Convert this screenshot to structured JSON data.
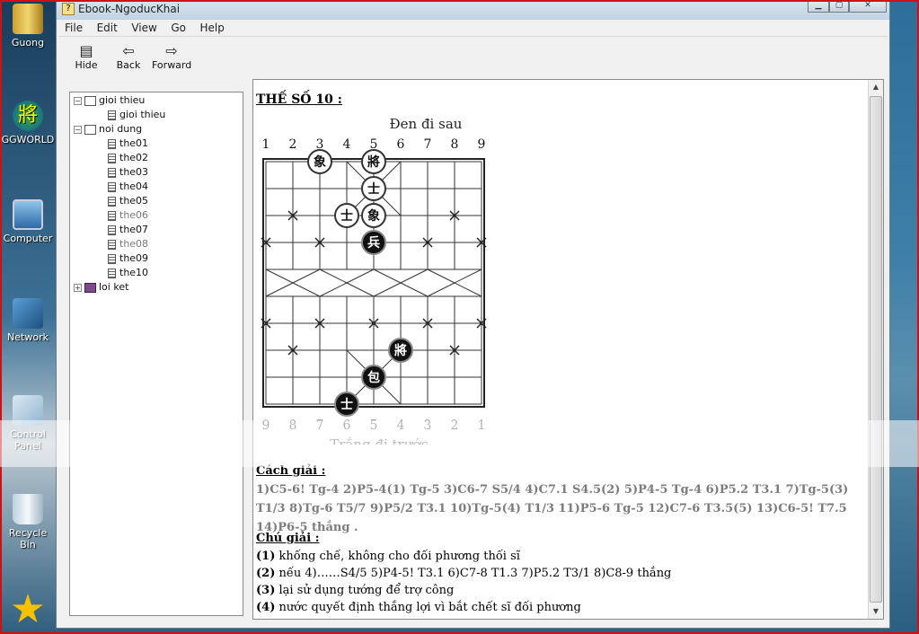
{
  "desktop": {
    "icons": [
      {
        "label": "Guong",
        "icon": "folder-icon"
      },
      {
        "label": "GGWORLD",
        "icon": "globe-app-icon"
      },
      {
        "label": "Computer",
        "icon": "computer-icon"
      },
      {
        "label": "Network",
        "icon": "network-icon"
      },
      {
        "label": "Control Panel",
        "icon": "control-panel-icon"
      },
      {
        "label": "Recycle Bin",
        "icon": "recycle-bin-icon"
      }
    ]
  },
  "window": {
    "title": "Ebook-NgoducKhai",
    "menu": [
      "File",
      "Edit",
      "View",
      "Go",
      "Help"
    ],
    "toolbar": {
      "hide": "Hide",
      "back": "Back",
      "forward": "Forward"
    }
  },
  "tree": {
    "nodes": [
      {
        "label": "gioi thieu",
        "type": "book-open",
        "expander": "-"
      },
      {
        "label": "gioi thieu",
        "type": "page"
      },
      {
        "label": "noi dung",
        "type": "book-open",
        "expander": "-"
      },
      {
        "label": "the01",
        "type": "page"
      },
      {
        "label": "the02",
        "type": "page"
      },
      {
        "label": "the03",
        "type": "page"
      },
      {
        "label": "the04",
        "type": "page"
      },
      {
        "label": "the05",
        "type": "page"
      },
      {
        "label": "the06",
        "type": "page"
      },
      {
        "label": "the07",
        "type": "page"
      },
      {
        "label": "the08",
        "type": "page"
      },
      {
        "label": "the09",
        "type": "page"
      },
      {
        "label": "the10",
        "type": "page"
      },
      {
        "label": "loi ket",
        "type": "book-closed",
        "expander": "+"
      }
    ]
  },
  "content": {
    "heading": "THẾ SỐ 10 :",
    "board": {
      "top_label": "Đen đi sau",
      "bottom_label": "Trắng đi trước",
      "top_files": [
        "1",
        "2",
        "3",
        "4",
        "5",
        "6",
        "7",
        "8",
        "9"
      ],
      "bottom_files": [
        "9",
        "8",
        "7",
        "6",
        "5",
        "4",
        "3",
        "2",
        "1"
      ],
      "pieces": [
        {
          "glyph": "象",
          "color": "white",
          "file": 2,
          "rank": 0
        },
        {
          "glyph": "將",
          "color": "white",
          "file": 4,
          "rank": 0
        },
        {
          "glyph": "士",
          "color": "white",
          "file": 4,
          "rank": 1
        },
        {
          "glyph": "士",
          "color": "white",
          "file": 3,
          "rank": 2
        },
        {
          "glyph": "象",
          "color": "white",
          "file": 4,
          "rank": 2
        },
        {
          "glyph": "兵",
          "color": "black",
          "file": 4,
          "rank": 3
        },
        {
          "glyph": "將",
          "color": "black",
          "file": 5,
          "rank": 7
        },
        {
          "glyph": "包",
          "color": "black",
          "file": 4,
          "rank": 8
        },
        {
          "glyph": "士",
          "color": "black",
          "file": 3,
          "rank": 9
        }
      ]
    },
    "solution_title": "Cách giải :",
    "solution_text": "1)C5-6! Tg-4 2)P5-4(1) Tg-5 3)C6-7 S5/4 4)C7.1 S4.5(2) 5)P4-5 Tg-4 6)P5.2 T3.1 7)Tg-5(3) T1/3 8)Tg-6 T5/7 9)P5/2 T3.1 10)Tg-5(4) T1/3 11)P5-6 Tg-5 12)C7-6 T3.5(5) 13)C6-5! T7.5 14)P6-5 thắng .",
    "notes_title": "Chú giải :",
    "notes": [
      {
        "num": "(1)",
        "text": " khống chế, không cho đối phương thối sĩ"
      },
      {
        "num": "(2)",
        "text": " nếu 4)……S4/5 5)P4-5! T3.1 6)C7-8 T1.3 7)P5.2 T3/1 8)C8-9 thắng"
      },
      {
        "num": "(3)",
        "text": " lại sử dụng tướng để trợ công"
      },
      {
        "num": "(4)",
        "text": " nước quyết định thắng lợi vì bắt chết sĩ đối phương"
      }
    ]
  }
}
